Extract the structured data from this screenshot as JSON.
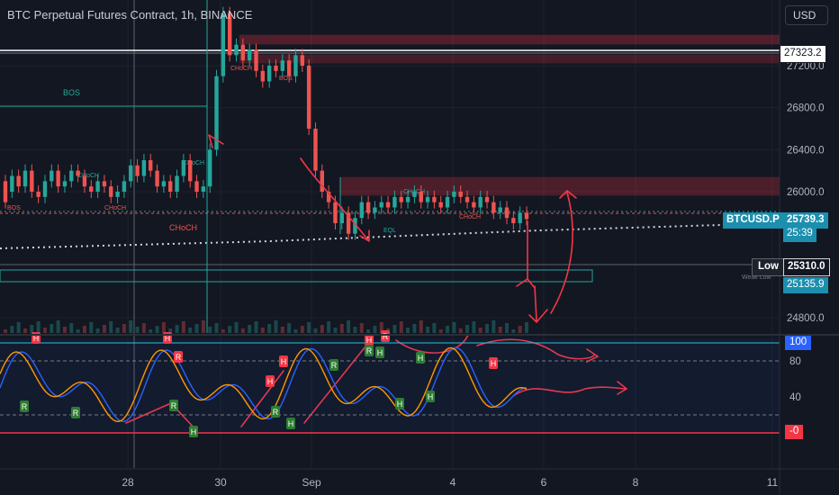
{
  "header": {
    "title": "BTC Perpetual Futures Contract, 1h, BINANCE",
    "currency_button": "USD"
  },
  "price_axis": {
    "ticks": [
      "27200.0",
      "26800.0",
      "26400.0",
      "26000.0",
      "24800.0"
    ],
    "current_price_line": "27323.2",
    "symbol": "BTCUSD.P",
    "last_price": "25739.3",
    "countdown": "25:39",
    "low_label": "Low",
    "low_price": "25310.0",
    "weak_low_price": "25135.9",
    "weak_low_note": "Weak Low"
  },
  "oscillator_axis": {
    "ticks": [
      "100",
      "80",
      "40",
      "-0"
    ]
  },
  "time_axis": {
    "ticks": [
      "28",
      "30",
      "Sep",
      "4",
      "6",
      "8",
      "11"
    ]
  },
  "annotations": {
    "bos": "BOS",
    "choch": "CHoCH",
    "eql": "EQL",
    "oscillator_h": "H",
    "oscillator_r": "R"
  },
  "colors": {
    "background": "#131722",
    "grid": "#1e222d",
    "candle_up": "#26a69a",
    "candle_down": "#ef5350",
    "supply_zone": "#f2364533",
    "pen_annotation": "#f23645",
    "oscillator_fast": "#2962ff",
    "oscillator_slow": "#ff9800",
    "structure_teal": "#26a69a",
    "structure_red": "#ef5350"
  },
  "chart_data": {
    "type": "candlestick",
    "title": "BTC Perpetual Futures Contract, 1h, BINANCE",
    "y_ticks": [
      27200,
      26800,
      26400,
      26000,
      24800
    ],
    "x_ticks": [
      "28",
      "30",
      "Sep",
      "4",
      "6",
      "8",
      "11"
    ],
    "last_price": 25739.3,
    "marked_levels": {
      "line_price": 27323.2,
      "low": 25310.0,
      "weak_low": 25135.9
    },
    "candles_approx": [
      [
        26100,
        25900
      ],
      [
        26000,
        26150
      ],
      [
        26150,
        26050
      ],
      [
        26050,
        26200
      ],
      [
        26200,
        26000
      ],
      [
        26000,
        25950
      ],
      [
        25950,
        26100
      ],
      [
        26100,
        26200
      ],
      [
        26200,
        26050
      ],
      [
        26050,
        26100
      ],
      [
        26100,
        26200
      ],
      [
        26200,
        26150
      ],
      [
        26150,
        26050
      ],
      [
        26050,
        26000
      ],
      [
        26000,
        26100
      ],
      [
        26100,
        26050
      ],
      [
        26050,
        25950
      ],
      [
        25950,
        26000
      ],
      [
        26000,
        26100
      ],
      [
        26100,
        26250
      ],
      [
        26250,
        26150
      ],
      [
        26150,
        26300
      ],
      [
        26300,
        26200
      ],
      [
        26200,
        26050
      ],
      [
        26050,
        26100
      ],
      [
        26100,
        26000
      ],
      [
        26000,
        26150
      ],
      [
        26150,
        26300
      ],
      [
        26300,
        26100
      ],
      [
        26100,
        26000
      ],
      [
        26000,
        26050
      ],
      [
        26050,
        26400
      ],
      [
        26400,
        27100
      ],
      [
        27100,
        27700
      ],
      [
        27700,
        27300
      ],
      [
        27300,
        27400
      ],
      [
        27400,
        27250
      ],
      [
        27250,
        27350
      ],
      [
        27350,
        27150
      ],
      [
        27150,
        27050
      ],
      [
        27050,
        27200
      ],
      [
        27200,
        27150
      ],
      [
        27150,
        27250
      ],
      [
        27250,
        27100
      ],
      [
        27100,
        27300
      ],
      [
        27300,
        27200
      ],
      [
        27200,
        26600
      ],
      [
        26600,
        26200
      ],
      [
        26200,
        26000
      ],
      [
        26000,
        25900
      ],
      [
        25900,
        25700
      ],
      [
        25700,
        25800
      ],
      [
        25800,
        25600
      ],
      [
        25600,
        25750
      ],
      [
        25750,
        25900
      ],
      [
        25900,
        25800
      ],
      [
        25800,
        25850
      ],
      [
        25850,
        25900
      ],
      [
        25900,
        25850
      ],
      [
        25850,
        25950
      ],
      [
        25950,
        25900
      ],
      [
        25900,
        25950
      ],
      [
        25950,
        26000
      ],
      [
        26000,
        25900
      ],
      [
        25900,
        25950
      ],
      [
        25950,
        25900
      ],
      [
        25900,
        25850
      ],
      [
        25850,
        25950
      ],
      [
        25950,
        26000
      ],
      [
        26000,
        25950
      ],
      [
        25950,
        25900
      ],
      [
        25900,
        25850
      ],
      [
        25850,
        25950
      ],
      [
        25950,
        25900
      ],
      [
        25900,
        25800
      ],
      [
        25800,
        25850
      ],
      [
        25850,
        25750
      ],
      [
        25750,
        25700
      ],
      [
        25700,
        25800
      ],
      [
        25800,
        25739.3
      ]
    ],
    "oscillator": {
      "ylim": [
        0,
        100
      ],
      "levels": [
        80,
        20
      ]
    }
  }
}
